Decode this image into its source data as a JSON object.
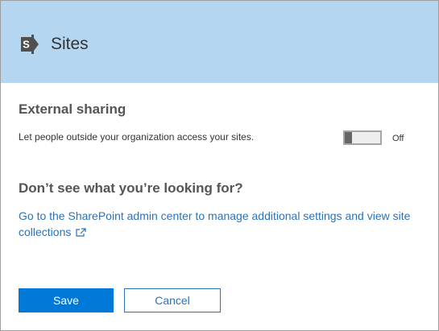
{
  "header": {
    "title": "Sites",
    "logo_icon": "sharepoint-icon",
    "background_color": "#b4d6f1"
  },
  "external_sharing": {
    "title": "External sharing",
    "description": "Let people outside your organization access your sites.",
    "toggle_state_label": "Off",
    "toggle_on": false
  },
  "help": {
    "title": "Don’t see what you’re looking for?",
    "link_text": "Go to the SharePoint admin center to manage additional settings and view site collections",
    "link_icon": "external-link-icon"
  },
  "actions": {
    "save_label": "Save",
    "cancel_label": "Cancel",
    "accent_color": "#0078d7"
  }
}
